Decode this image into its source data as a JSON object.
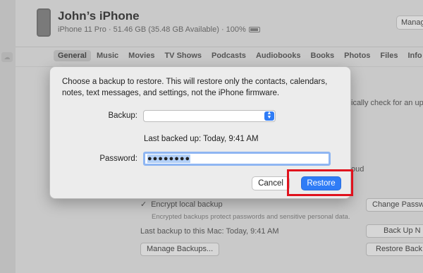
{
  "device": {
    "name": "John’s iPhone",
    "info": "iPhone 11 Pro · 51.46 GB (35.48 GB Available) · 100%",
    "manage_label": "Manage"
  },
  "tabs": [
    {
      "label": "General"
    },
    {
      "label": "Music"
    },
    {
      "label": "Movies"
    },
    {
      "label": "TV Shows"
    },
    {
      "label": "Podcasts"
    },
    {
      "label": "Audiobooks"
    },
    {
      "label": "Books"
    },
    {
      "label": "Photos"
    },
    {
      "label": "Files"
    },
    {
      "label": "Info"
    }
  ],
  "background": {
    "auto_check_text": "ically check for an up",
    "icloud_text": "oud",
    "encrypt_label": "Encrypt local backup",
    "encrypt_desc": "Encrypted backups protect passwords and sensitive personal data.",
    "change_password_label": "Change Passw",
    "last_backup_text": "Last backup to this Mac:  Today, 9:41 AM",
    "back_up_now_label": "Back Up N",
    "manage_backups_label": "Manage Backups...",
    "restore_backup_label": "Restore Back"
  },
  "dialog": {
    "message": "Choose a backup to restore. This will restore only the contacts, calendars, notes, text messages, and settings, not the iPhone firmware.",
    "backup_label": "Backup:",
    "backup_value": "",
    "last_backed_up": "Last backed up:  Today, 9:41 AM",
    "password_label": "Password:",
    "password_value": "●●●●●●●●",
    "cancel_label": "Cancel",
    "restore_label": "Restore"
  },
  "colors": {
    "accent": "#2f7cf6",
    "highlight": "#e0121d"
  }
}
